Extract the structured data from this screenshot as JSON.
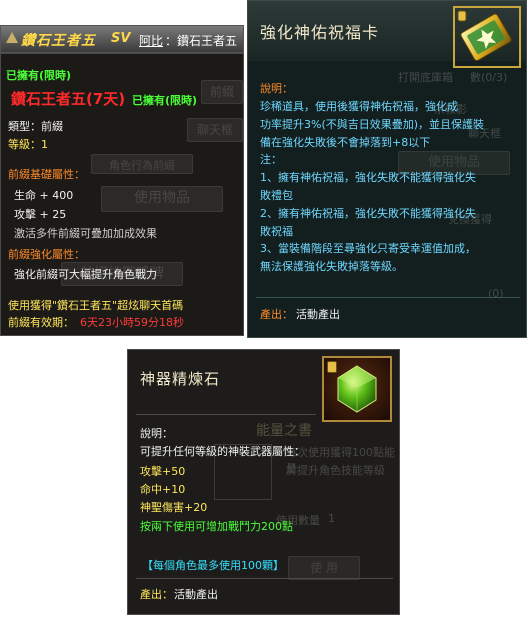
{
  "title_tooltip": {
    "banner_title": "鑽石王者五",
    "sv_tag": "SV",
    "owner_link": "阿比",
    "owner_title": "：鑽石王者五",
    "owned_status_top": "已擁有(限時)",
    "item_name": "鑽石王者五(7天)",
    "owned_status": "已擁有(限時)",
    "type_label": "類型：前綴",
    "level_label": "等級：1",
    "base_attr_heading": "前綴基礎屬性：",
    "stats": [
      "生命 + 400",
      "攻擊 + 25"
    ],
    "activation_note": "激活多件前綴可疊加加成效果",
    "enhance_heading": "前綴強化屬性：",
    "enhance_text": "強化前綴可大幅提升角色戰力",
    "footer_line": "使用獲得\"鑽石王者五\"超炫聊天首碼",
    "validity_label": "前綴有效期：",
    "validity_value": "6天23小時59分18秒",
    "ghost_labels": [
      "前綴",
      "聊天框",
      "角色行為前綴",
      "使用物品",
      "前綴挑戰獎牌"
    ]
  },
  "blessing_card": {
    "title": "強化神佑祝福卡",
    "desc_heading": "說明：",
    "desc_lines": [
      "珍稀道具，使用後獲得神佑祝福，強化成",
      "功率提升3%(不與吉日效果疊加)，並且保護裝",
      "備在強化失敗後不會掉落到+8以下",
      "注：",
      "1、擁有神佑祝福，強化失敗不能獲得強化失",
      "敗禮包",
      "2、擁有神佑祝福，強化失敗不能獲得強化失",
      "敗祝福",
      "3、當裝備階段至尋強化只寄受幸運值加成，",
      "無法保護強化失敗掉落等級。"
    ],
    "source_label": "產出：",
    "source_value": "活動產出",
    "ghost_labels": [
      "打開底庫箱",
      "宗教影",
      "聊天框",
      "使用物品",
      "兌換獲得",
      "使用物品"
    ],
    "ghost_counts": [
      "數(0/3)",
      "(0)"
    ]
  },
  "refine_stone": {
    "title": "神器精煉石",
    "desc_heading": "說明：",
    "desc_line": "可提升任何等級的神裝武器屬性：",
    "stats": [
      "攻擊+50",
      "命中+10",
      "神聖傷害+20"
    ],
    "combat_note": "按兩下使用可增加戰鬥力200點",
    "limit_note": "【每個角色最多使用100顆】",
    "source_label": "產出：",
    "source_value": "活動產出",
    "ghost_title": "能量之書",
    "ghost_line1": "每次使用獲得100點能量",
    "ghost_line2": "於提升角色技能等級",
    "ghost_qty_label": "使用數量",
    "ghost_qty_value": "1",
    "ghost_use_button": "使 用"
  }
}
